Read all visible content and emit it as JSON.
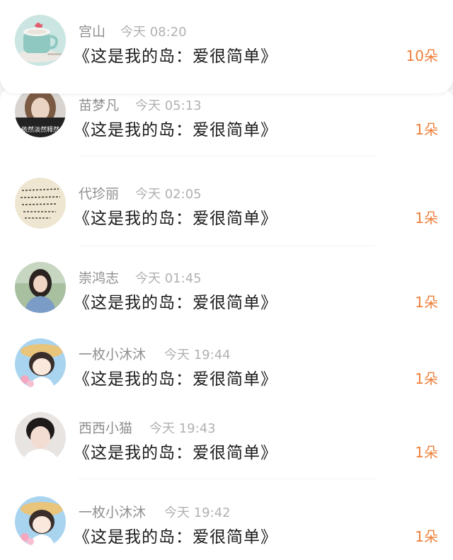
{
  "colors": {
    "name": "#8f8f8f",
    "time": "#b1b1b1",
    "message": "#1c1c1c",
    "count": "#ef7f3a"
  },
  "gifts": [
    {
      "name": "宫山",
      "time": "今天 08:20",
      "message": "《这是我的岛：爱很简单》",
      "count": "10朵",
      "avatar": "teacup-avatar"
    },
    {
      "name": "苗梦凡",
      "time": "今天 05:13",
      "message": "《这是我的岛：爱很简单》",
      "count": "1朵",
      "avatar": "girl-with-caption-avatar",
      "avatar_caption": "依然淡然释然"
    },
    {
      "name": "代珍丽",
      "time": "今天 02:05",
      "message": "《这是我的岛：爱很简单》",
      "count": "1朵",
      "avatar": "handwriting-avatar"
    },
    {
      "name": "崇鸿志",
      "time": "今天 01:45",
      "message": "《这是我的岛：爱很简单》",
      "count": "1朵",
      "avatar": "girl-photo-avatar"
    },
    {
      "name": "一枚小沐沐",
      "time": "今天 19:44",
      "message": "《这是我的岛：爱很简单》",
      "count": "1朵",
      "avatar": "cartoon-girl-avatar"
    },
    {
      "name": "西西小猫",
      "time": "今天 19:43",
      "message": "《这是我的岛：爱很简单》",
      "count": "1朵",
      "avatar": "boy-photo-avatar"
    },
    {
      "name": "一枚小沐沐",
      "time": "今天 19:42",
      "message": "《这是我的岛：爱很简单》",
      "count": "1朵",
      "avatar": "cartoon-girl-avatar"
    }
  ]
}
